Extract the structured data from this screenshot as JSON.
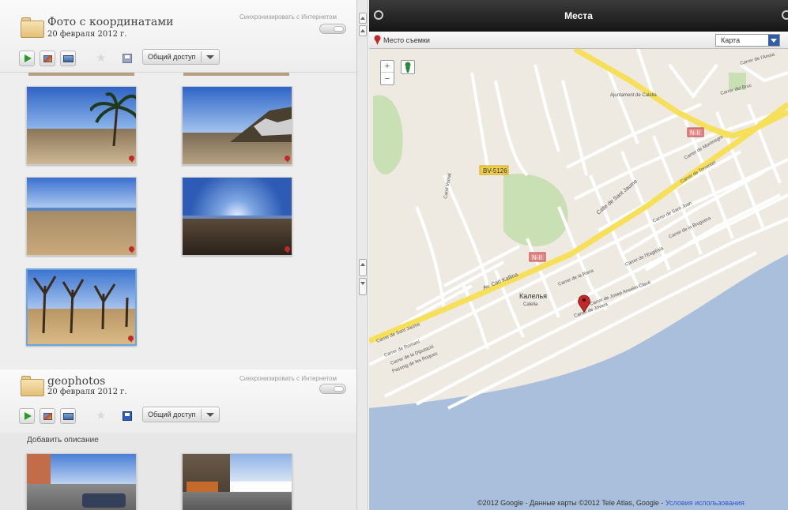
{
  "album1": {
    "title": "Фото с координатами",
    "date": "20 февраля 2012 г.",
    "sync_label": "Синхронизировать с Интернетом",
    "share_label": "Общий доступ"
  },
  "album2": {
    "title": "geophotos",
    "date": "20 февраля 2012 г.",
    "sync_label": "Синхронизировать с Интернетом",
    "share_label": "Общий доступ",
    "description_placeholder": "Добавить описание"
  },
  "map_panel": {
    "title": "Места",
    "shot_place_label": "Место съемки",
    "map_type": "Карта",
    "zoom_in": "+",
    "zoom_out": "−",
    "attribution": "©2012 Google - Данные карты ©2012 Tele Atlas, Google - ",
    "terms_link": "Условия использования",
    "town_name": "Калелья",
    "town_sub": "Calella",
    "road_labels": [
      "BV-5126",
      "N-II",
      "N-II"
    ],
    "street_labels": [
      "Carrer de Sant Jaume",
      "Carrer de Jovara",
      "Carrer de la Riera",
      "Carrer de l'Església",
      "Carrer de Josep Anselm Clavé",
      "Carrer de la Diputació",
      "Carrer de Romaní",
      "Carrer de Sant Joan",
      "Calle de Sant Jaume",
      "Carrer de l'Anoia",
      "Carrer del Bruc",
      "Carrer de Torrentet",
      "Ajuntament de Calella",
      "Av. Carl Kallina",
      "Passeig de les Roques",
      "Carrer de Montnegre",
      "Carrer de la Bruguera",
      "Camí Veïnal"
    ]
  },
  "colors": {
    "sea": "#a9bfdc",
    "land": "#eeeae2",
    "highway": "#f6e05a",
    "pin": "#c0282a",
    "titlebar": "#1e1e1e"
  },
  "icons": [
    "folder-icon",
    "play-icon",
    "image-edit-icon",
    "image-icon",
    "star-icon",
    "save-icon",
    "chevron-down-icon",
    "map-pin-icon",
    "pegman-icon"
  ]
}
